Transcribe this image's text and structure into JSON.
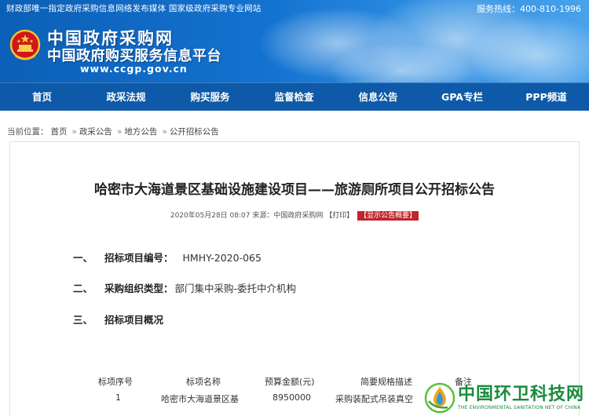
{
  "header": {
    "topline": "财政部唯一指定政府采购信息网络发布媒体  国家级政府采购专业网站",
    "hotline": "服务热线：400-810-1996",
    "site_title": "中国政府采购网",
    "site_subtitle": "中国政府购买服务信息平台",
    "site_url": "www.ccgp.gov.cn"
  },
  "nav": {
    "items": [
      "首页",
      "政采法规",
      "购买服务",
      "监督检查",
      "信息公告",
      "GPA专栏",
      "PPP频道"
    ]
  },
  "breadcrumb": {
    "prefix": "当前位置：",
    "items": [
      "首页",
      "政采公告",
      "地方公告",
      "公开招标公告"
    ]
  },
  "article": {
    "title": "哈密市大海道景区基础设施建设项目——旅游厕所项目公开招标公告",
    "date": "2020年05月28日 08:07",
    "source": "来源：中国政府采购网",
    "print_label": "【打印】",
    "summary_label": "【显示公告概要】",
    "sections": [
      {
        "num": "一、",
        "label": "招标项目编号：",
        "value": "HMHY-2020-065"
      },
      {
        "num": "二、",
        "label": "采购组织类型：",
        "value": "部门集中采购-委托中介机构"
      },
      {
        "num": "三、",
        "label": "招标项目概况",
        "value": ""
      }
    ],
    "table": {
      "headers": [
        "标项序号",
        "标项名称",
        "预算金额(元)",
        "简要规格描述",
        "备注"
      ],
      "rows": [
        [
          "1",
          "哈密市大海道景区基",
          "8950000",
          "采购装配式吊装真空",
          ""
        ]
      ]
    }
  },
  "watermark": {
    "text": "中国环卫科技网",
    "subtext": "THE ENVIRONMENTAL SANITATION NET OF CHINA"
  }
}
